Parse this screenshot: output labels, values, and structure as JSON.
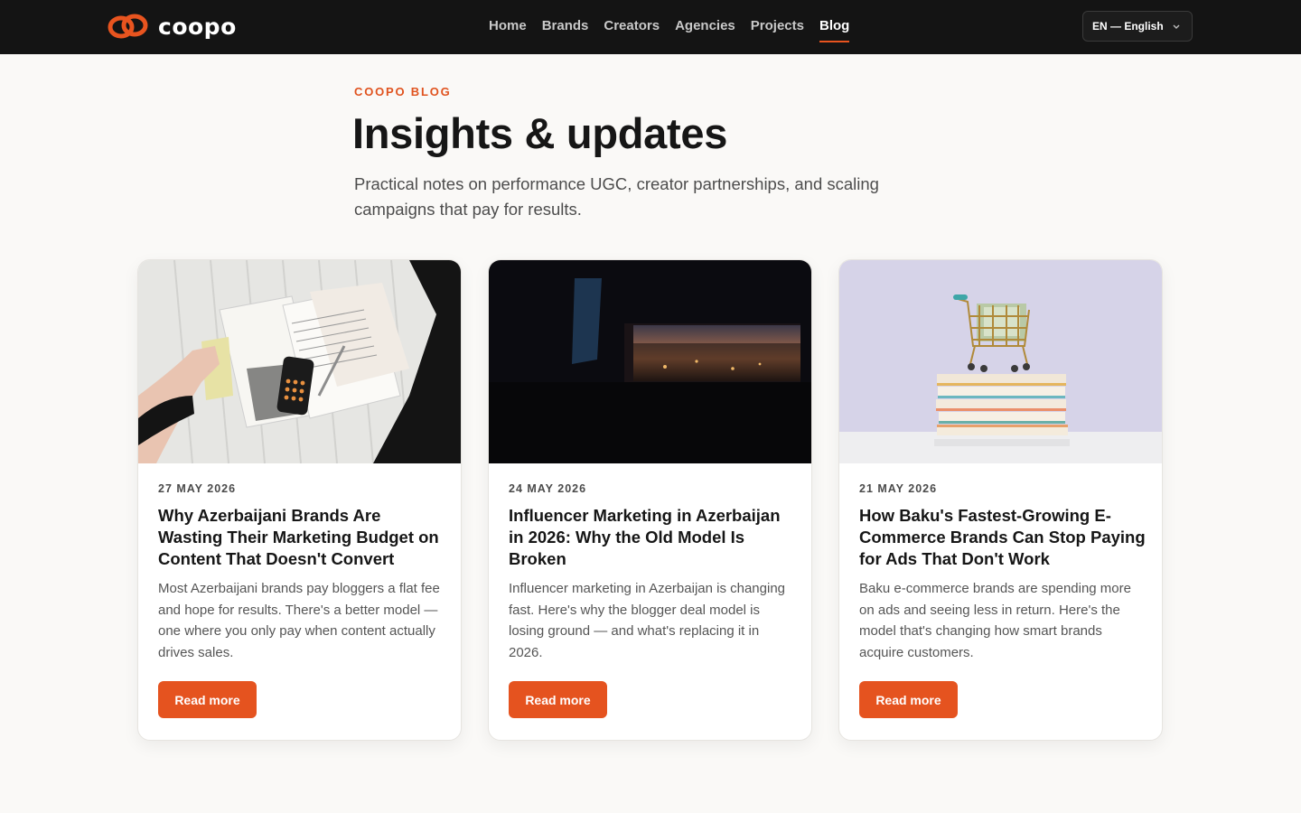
{
  "brand": {
    "name": "coopo",
    "accent": "#e5531f"
  },
  "nav": {
    "items": [
      {
        "label": "Home"
      },
      {
        "label": "Brands"
      },
      {
        "label": "Creators"
      },
      {
        "label": "Agencies"
      },
      {
        "label": "Projects"
      },
      {
        "label": "Blog",
        "active": true
      }
    ]
  },
  "language": {
    "selected": "EN — English"
  },
  "hero": {
    "eyebrow": "COOPO BLOG",
    "title": "Insights & updates",
    "subtitle": "Practical notes on performance UGC, creator partnerships, and scaling campaigns that pay for results."
  },
  "posts": [
    {
      "date": "27 MAY 2026",
      "title": "Why Azerbaijani Brands Are Wasting Their Marketing Budget on Content That Doesn't Convert",
      "excerpt": "Most Azerbaijani brands pay bloggers a flat fee and hope for results. There's a better model — one where you only pay when content actually drives sales.",
      "cta": "Read more",
      "image": "paperwork-calculator-photo"
    },
    {
      "date": "24 MAY 2026",
      "title": "Influencer Marketing in Azerbaijan in 2026: Why the Old Model Is Broken",
      "excerpt": "Influencer marketing in Azerbaijan is changing fast. Here's why the blogger deal model is losing ground — and what's replacing it in 2026.",
      "cta": "Read more",
      "image": "city-window-sunset-photo"
    },
    {
      "date": "21 MAY 2026",
      "title": "How Baku's Fastest-Growing E-Commerce Brands Can Stop Paying for Ads That Don't Work",
      "excerpt": "Baku e-commerce brands are spending more on ads and seeing less in return. Here's the model that's changing how smart brands acquire customers.",
      "cta": "Read more",
      "image": "shopping-cart-books-photo"
    }
  ]
}
